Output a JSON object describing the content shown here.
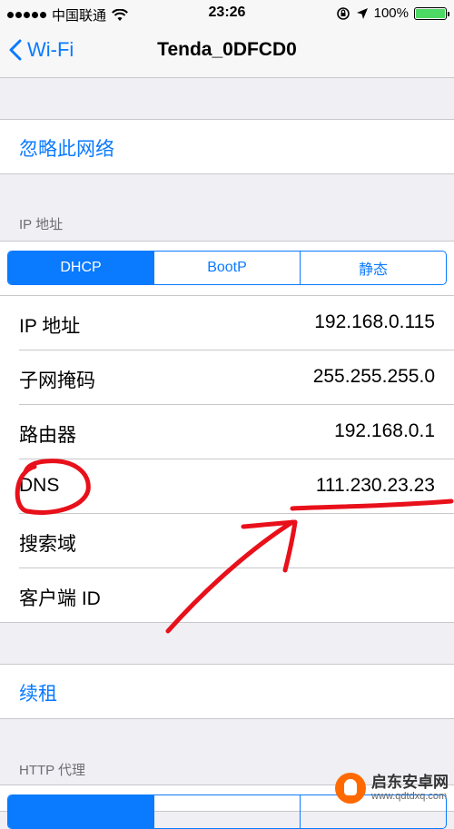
{
  "status_bar": {
    "carrier": "中国联通",
    "time": "23:26",
    "battery": "100%",
    "battery_level": 1.0
  },
  "nav": {
    "back_label": "Wi-Fi",
    "title": "Tenda_0DFCD0"
  },
  "forget_network": "忽略此网络",
  "ip_section": {
    "header": "IP 地址",
    "segments": [
      "DHCP",
      "BootP",
      "静态"
    ],
    "selected_segment": "DHCP",
    "rows": [
      {
        "label": "IP 地址",
        "value": "192.168.0.115"
      },
      {
        "label": "子网掩码",
        "value": "255.255.255.0"
      },
      {
        "label": "路由器",
        "value": "192.168.0.1"
      },
      {
        "label": "DNS",
        "value": "111.230.23.23"
      },
      {
        "label": "搜索域",
        "value": ""
      },
      {
        "label": "客户端 ID",
        "value": ""
      }
    ]
  },
  "renew_lease": "续租",
  "http_proxy": {
    "header": "HTTP 代理"
  },
  "watermark": {
    "name": "启东安卓网",
    "url": "www.qdtdxq.com"
  },
  "colors": {
    "accent": "#0a7aff",
    "background": "#efeff4",
    "annotation": "#e8101a",
    "battery": "#4cd964"
  }
}
